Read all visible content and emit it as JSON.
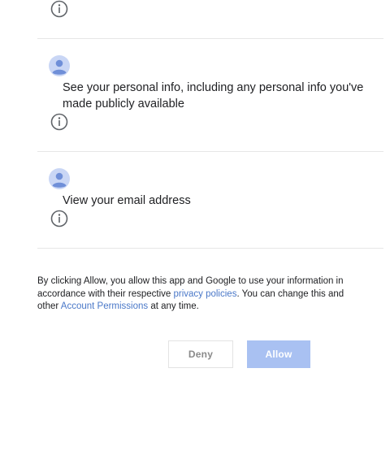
{
  "permissions": [
    {
      "text": "See your personal info, including any personal info you've made publicly available",
      "avatar_icon": "account-avatar-icon",
      "info_icon": "info-circle-icon"
    },
    {
      "text": "View your email address",
      "avatar_icon": "account-avatar-icon",
      "info_icon": "info-circle-icon"
    }
  ],
  "disclaimer": {
    "part1": "By clicking Allow, you allow this app and Google to use your information in accordance with their respective ",
    "privacy_link": "privacy policies",
    "part2": ". You can change this and other ",
    "account_link": "Account Permissions",
    "part3": " at any time."
  },
  "buttons": {
    "deny_label": "Deny",
    "allow_label": "Allow"
  },
  "colors": {
    "link": "#4a78c8",
    "avatar_bg": "#c9d6f5",
    "avatar_fg": "#6f8fd8",
    "allow_bg": "#a9c1f2",
    "divider": "#e6e6e6"
  }
}
